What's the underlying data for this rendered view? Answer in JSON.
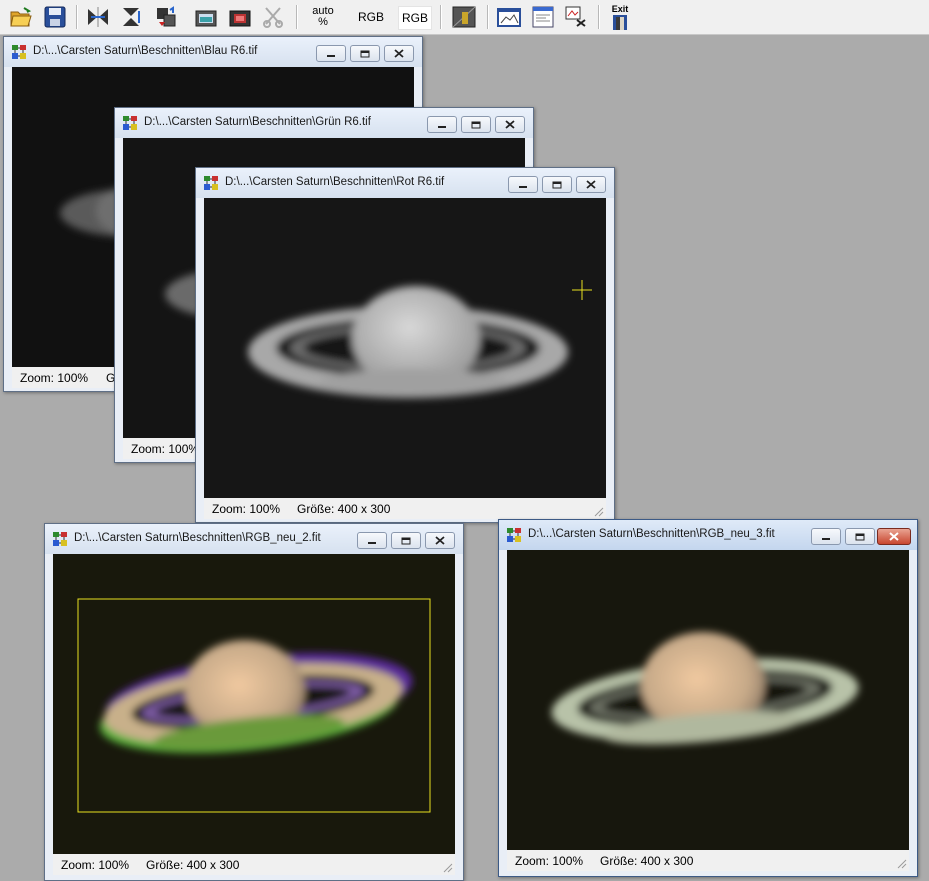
{
  "toolbar": {
    "icons": [
      "open-folder-icon",
      "save-icon",
      "flip-horizontal-icon",
      "flip-vertical-icon",
      "rotate-icon",
      "screen-icon",
      "camera-icon",
      "crop-icon"
    ],
    "auto_line1": "auto",
    "auto_line2": "%",
    "rgb1": "RGB",
    "rgb2": "RGB",
    "exit": "Exit"
  },
  "windows": {
    "blau": {
      "title": "D:\\...\\Carsten Saturn\\Beschnitten\\Blau R6.tif",
      "zoom": "Zoom: 100%",
      "size": "Gr"
    },
    "gruen": {
      "title": "D:\\...\\Carsten Saturn\\Beschnitten\\Grün R6.tif",
      "zoom": "Zoom: 100%"
    },
    "rot": {
      "title": "D:\\...\\Carsten Saturn\\Beschnitten\\Rot R6.tif",
      "zoom": "Zoom: 100%",
      "size": "Größe: 400 x 300"
    },
    "rgb2": {
      "title": "D:\\...\\Carsten Saturn\\Beschnitten\\RGB_neu_2.fit",
      "zoom": "Zoom: 100%",
      "size": "Größe: 400 x 300"
    },
    "rgb3": {
      "title": "D:\\...\\Carsten Saturn\\Beschnitten\\RGB_neu_3.fit",
      "zoom": "Zoom: 100%",
      "size": "Größe: 400 x 300"
    }
  },
  "colors": {
    "workspace": "#ababab",
    "selection": "#e8e020",
    "crosshair": "#e8e020",
    "close_red": "#c8462f"
  }
}
